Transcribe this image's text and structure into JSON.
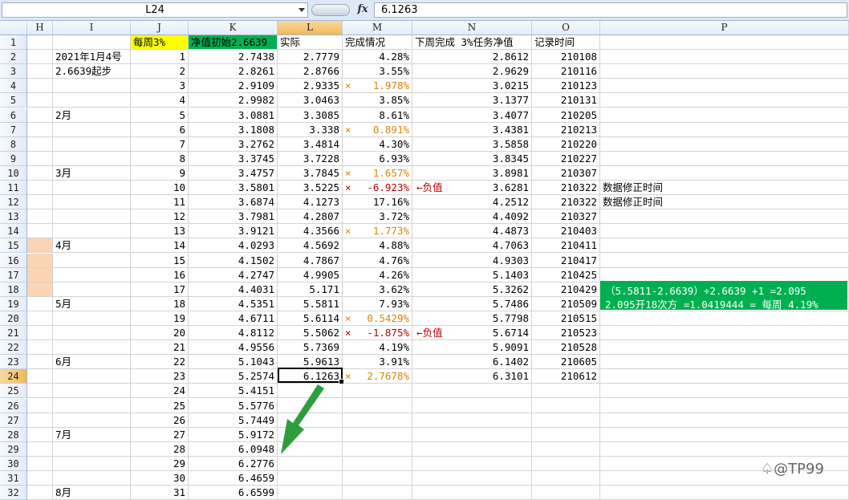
{
  "formula_bar": {
    "name_box": "L24",
    "fx_label": "fx",
    "value": "6.1263"
  },
  "columns": [
    "H",
    "I",
    "J",
    "K",
    "L",
    "M",
    "N",
    "O",
    "P"
  ],
  "selected_column": "L",
  "selected_row": 24,
  "rows": [
    {
      "n": "1",
      "I": "",
      "J": "每周3%",
      "K": "净值初始2.6639",
      "L": "实际",
      "M": "完成情况",
      "N": "下周完成  3%任务净值",
      "O": "记录时间",
      "note": ""
    },
    {
      "n": "2",
      "I": "2021年1月4号",
      "J": "1",
      "K": "2.7438",
      "L": "2.7779",
      "M": "4.28%",
      "N": "2.8612",
      "O": "210108",
      "note": ""
    },
    {
      "n": "3",
      "I": "2.6639起步",
      "J": "2",
      "K": "2.8261",
      "L": "2.8766",
      "M": "3.55%",
      "N": "2.9629",
      "O": "210116",
      "note": ""
    },
    {
      "n": "4",
      "I": "",
      "J": "3",
      "K": "2.9109",
      "L": "2.9335",
      "M": "1.978%",
      "N": "3.0215",
      "O": "210123",
      "note": "",
      "x": "×",
      "mc": "o"
    },
    {
      "n": "5",
      "I": "",
      "J": "4",
      "K": "2.9982",
      "L": "3.0463",
      "M": "3.85%",
      "N": "3.1377",
      "O": "210131",
      "note": ""
    },
    {
      "n": "6",
      "I": "2月",
      "J": "5",
      "K": "3.0881",
      "L": "3.3085",
      "M": "8.61%",
      "N": "3.4077",
      "O": "210205",
      "note": ""
    },
    {
      "n": "7",
      "I": "",
      "J": "6",
      "K": "3.1808",
      "L": "3.338",
      "M": "0.891%",
      "N": "3.4381",
      "O": "210213",
      "note": "",
      "x": "×",
      "mc": "o"
    },
    {
      "n": "8",
      "I": "",
      "J": "7",
      "K": "3.2762",
      "L": "3.4814",
      "M": "4.30%",
      "N": "3.5858",
      "O": "210220",
      "note": ""
    },
    {
      "n": "9",
      "I": "",
      "J": "8",
      "K": "3.3745",
      "L": "3.7228",
      "M": "6.93%",
      "N": "3.8345",
      "O": "210227",
      "note": ""
    },
    {
      "n": "10",
      "I": "3月",
      "J": "9",
      "K": "3.4757",
      "L": "3.7845",
      "M": "1.657%",
      "N": "3.8981",
      "O": "210307",
      "note": "",
      "x": "×",
      "mc": "o"
    },
    {
      "n": "11",
      "I": "",
      "J": "10",
      "K": "3.5801",
      "L": "3.5225",
      "M": "-6.923%",
      "N": "3.6281",
      "O": "210322",
      "note": "数据修正时间",
      "x": "×",
      "mc": "r",
      "neg": "←负值"
    },
    {
      "n": "12",
      "I": "",
      "J": "11",
      "K": "3.6874",
      "L": "4.1273",
      "M": "17.16%",
      "N": "4.2512",
      "O": "210322",
      "note": "数据修正时间"
    },
    {
      "n": "13",
      "I": "",
      "J": "12",
      "K": "3.7981",
      "L": "4.2807",
      "M": "3.72%",
      "N": "4.4092",
      "O": "210327",
      "note": ""
    },
    {
      "n": "14",
      "I": "",
      "J": "13",
      "K": "3.9121",
      "L": "4.3566",
      "M": "1.773%",
      "N": "4.4873",
      "O": "210403",
      "note": "",
      "x": "×",
      "mc": "o"
    },
    {
      "n": "15",
      "I": "4月",
      "J": "14",
      "K": "4.0293",
      "L": "4.5692",
      "M": "4.88%",
      "N": "4.7063",
      "O": "210411",
      "note": ""
    },
    {
      "n": "16",
      "I": "",
      "J": "15",
      "K": "4.1502",
      "L": "4.7867",
      "M": "4.76%",
      "N": "4.9303",
      "O": "210417",
      "note": ""
    },
    {
      "n": "17",
      "I": "",
      "J": "16",
      "K": "4.2747",
      "L": "4.9905",
      "M": "4.26%",
      "N": "5.1403",
      "O": "210425",
      "note": ""
    },
    {
      "n": "18",
      "I": "",
      "J": "17",
      "K": "4.4031",
      "L": "5.171",
      "M": "3.62%",
      "N": "5.3262",
      "O": "210429",
      "note": ""
    },
    {
      "n": "19",
      "I": "5月",
      "J": "18",
      "K": "4.5351",
      "L": "5.5811",
      "M": "7.93%",
      "N": "5.7486",
      "O": "210509",
      "note": ""
    },
    {
      "n": "20",
      "I": "",
      "J": "19",
      "K": "4.6711",
      "L": "5.6114",
      "M": "0.5429%",
      "N": "5.7798",
      "O": "210515",
      "note": "",
      "x": "×",
      "mc": "o"
    },
    {
      "n": "21",
      "I": "",
      "J": "20",
      "K": "4.8112",
      "L": "5.5062",
      "M": "-1.875%",
      "N": "5.6714",
      "O": "210523",
      "note": "",
      "x": "×",
      "mc": "r",
      "neg": "←负值"
    },
    {
      "n": "22",
      "I": "",
      "J": "21",
      "K": "4.9556",
      "L": "5.7369",
      "M": "4.19%",
      "N": "5.9091",
      "O": "210528",
      "note": ""
    },
    {
      "n": "23",
      "I": "6月",
      "J": "22",
      "K": "5.1043",
      "L": "5.9613",
      "M": "3.91%",
      "N": "6.1402",
      "O": "210605",
      "note": ""
    },
    {
      "n": "24",
      "I": "",
      "J": "23",
      "K": "5.2574",
      "L": "6.1263",
      "M": "2.7678%",
      "N": "6.3101",
      "O": "210612",
      "note": "",
      "x": "×",
      "mc": "o"
    },
    {
      "n": "25",
      "I": "",
      "J": "24",
      "K": "5.4151",
      "L": "",
      "M": "",
      "N": "",
      "O": "",
      "note": ""
    },
    {
      "n": "26",
      "I": "",
      "J": "25",
      "K": "5.5776",
      "L": "",
      "M": "",
      "N": "",
      "O": "",
      "note": ""
    },
    {
      "n": "27",
      "I": "",
      "J": "26",
      "K": "5.7449",
      "L": "",
      "M": "",
      "N": "",
      "O": "",
      "note": ""
    },
    {
      "n": "28",
      "I": "7月",
      "J": "27",
      "K": "5.9172",
      "L": "",
      "M": "",
      "N": "",
      "O": "",
      "note": ""
    },
    {
      "n": "29",
      "I": "",
      "J": "28",
      "K": "6.0948",
      "L": "",
      "M": "",
      "N": "",
      "O": "",
      "note": ""
    },
    {
      "n": "30",
      "I": "",
      "J": "29",
      "K": "6.2776",
      "L": "",
      "M": "",
      "N": "",
      "O": "",
      "note": ""
    },
    {
      "n": "31",
      "I": "",
      "J": "30",
      "K": "6.4659",
      "L": "",
      "M": "",
      "N": "",
      "O": "",
      "note": ""
    },
    {
      "n": "32",
      "I": "8月",
      "J": "31",
      "K": "6.6599",
      "L": "",
      "M": "",
      "N": "",
      "O": "",
      "note": ""
    }
  ],
  "green_note": {
    "line1": "（5.5811-2.6639）÷2.6639 +1 =2.095",
    "line2": "2.095开18次方 =1.0419444 = 每周 4.19%"
  },
  "watermark": "@TP99",
  "colors": {
    "header_yellow": "#ffff00",
    "header_green": "#00b050",
    "peach": "#fbd4b4",
    "arrow_green": "#2e9e3c",
    "mark_orange": "#d9840b",
    "mark_red": "#c00000"
  }
}
